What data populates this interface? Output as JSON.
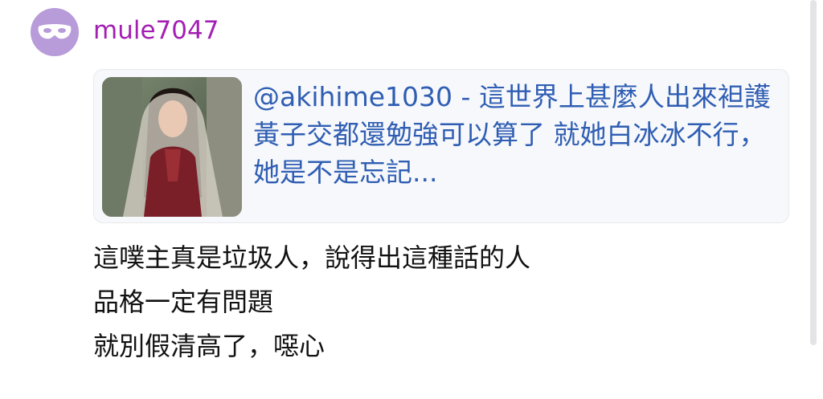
{
  "post": {
    "username": "mule7047",
    "avatar_icon": "mask-icon",
    "quote": {
      "text": "@akihime1030 - 這世界上甚麼人出來袒護黃子交都還勉強可以算了 就她白冰冰不行，她是不是忘記..."
    },
    "body_lines": [
      "這噗主真是垃圾人，說得出這種話的人",
      "品格一定有問題",
      "就別假清高了，噁心"
    ]
  },
  "colors": {
    "username": "#a31fb3",
    "avatar_bg": "#b89bd9",
    "quote_text": "#2f5eb3",
    "quote_bg": "#f7f8fb",
    "body_text": "#111111"
  }
}
